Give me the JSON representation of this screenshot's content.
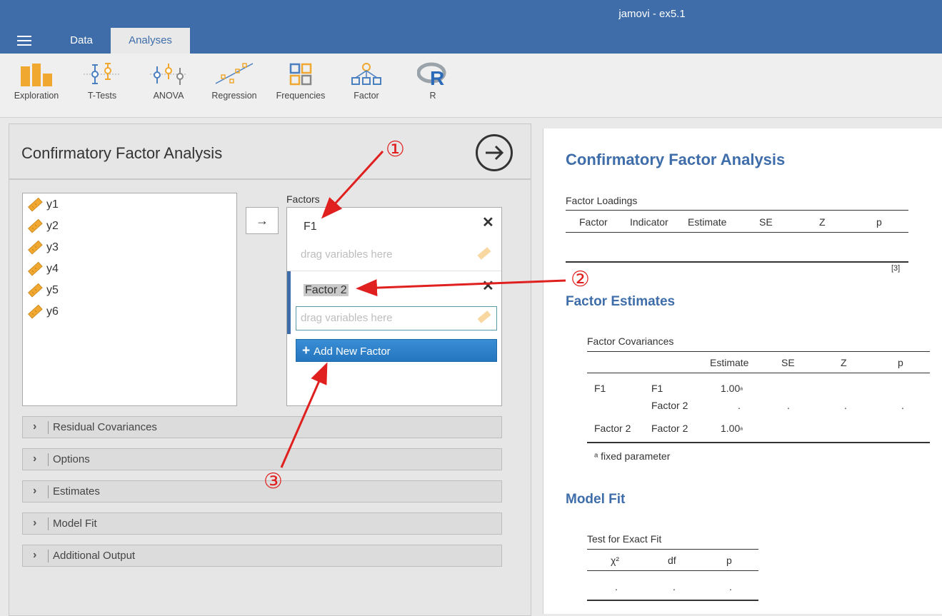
{
  "app": {
    "title": "jamovi - ex5.1"
  },
  "tabs": [
    {
      "label": "Data"
    },
    {
      "label": "Analyses"
    }
  ],
  "ribbon": [
    {
      "label": "Exploration",
      "icon": "exploration-icon"
    },
    {
      "label": "T-Tests",
      "icon": "t-tests-icon"
    },
    {
      "label": "ANOVA",
      "icon": "anova-icon"
    },
    {
      "label": "Regression",
      "icon": "regression-icon"
    },
    {
      "label": "Frequencies",
      "icon": "frequencies-icon"
    },
    {
      "label": "Factor",
      "icon": "factor-icon"
    },
    {
      "label": "R",
      "icon": "r-icon"
    }
  ],
  "panel": {
    "title": "Confirmatory Factor Analysis",
    "move_arrow": "→",
    "variables": [
      "y1",
      "y2",
      "y3",
      "y4",
      "y5",
      "y6"
    ],
    "factors_label": "Factors",
    "factors": [
      {
        "name": "F1",
        "placeholder": "drag variables here"
      },
      {
        "name": "Factor 2",
        "placeholder": "drag variables here"
      }
    ],
    "add_factor_label": "Add New Factor",
    "sections": [
      "Residual Covariances",
      "Options",
      "Estimates",
      "Model Fit",
      "Additional Output"
    ]
  },
  "results": {
    "title": "Confirmatory Factor Analysis",
    "factor_loadings": {
      "caption": "Factor Loadings",
      "headers": [
        "Factor",
        "Indicator",
        "Estimate",
        "SE",
        "Z",
        "p"
      ],
      "note": "[3]"
    },
    "factor_estimates": {
      "heading": "Factor Estimates",
      "caption": "Factor Covariances",
      "headers": [
        "Estimate",
        "SE",
        "Z",
        "p"
      ],
      "rows": [
        {
          "a": "F1",
          "b": "F1",
          "estimate": "1.00",
          "mark": "ᵃ",
          "se": "",
          "z": "",
          "p": ""
        },
        {
          "a": "",
          "b": "Factor 2",
          "estimate": ".",
          "mark": "",
          "se": ".",
          "z": ".",
          "p": "."
        },
        {
          "a": "Factor 2",
          "b": "Factor 2",
          "estimate": "1.00",
          "mark": "ᵃ",
          "se": "",
          "z": "",
          "p": ""
        }
      ],
      "footnote": "ᵃ fixed parameter"
    },
    "model_fit": {
      "heading": "Model Fit",
      "caption": "Test for Exact Fit",
      "headers": [
        "χ²",
        "df",
        "p"
      ],
      "row": [
        ".",
        ".",
        "."
      ]
    }
  },
  "annotations": [
    "①",
    "②",
    "③"
  ],
  "colors": {
    "brand": "#3e6da9",
    "button": "#2a80c8",
    "annotation": "#e0201e",
    "ribbon_icon": "#f0a830"
  }
}
